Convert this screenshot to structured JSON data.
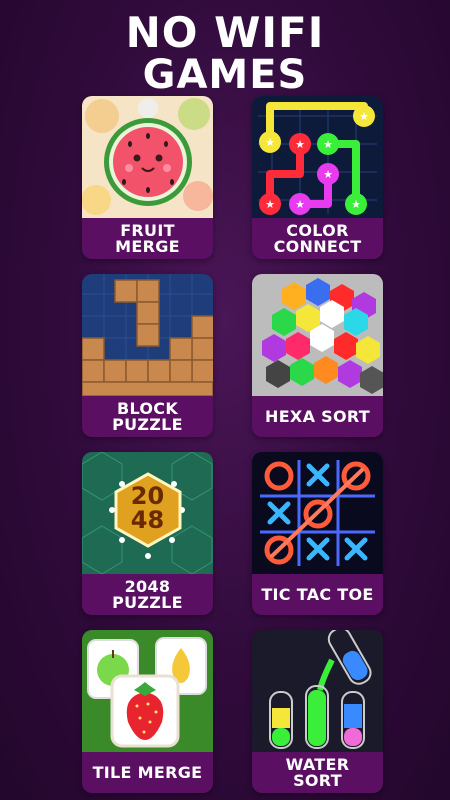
{
  "title": {
    "line1": "NO WIFI",
    "line2": "GAMES"
  },
  "games": [
    {
      "name": "FRUIT\nMERGE",
      "icon": "watermelon-icon"
    },
    {
      "name": "COLOR\nCONNECT",
      "icon": "color-connect-icon"
    },
    {
      "name": "BLOCK\nPUZZLE",
      "icon": "wood-blocks-icon"
    },
    {
      "name": "HEXA SORT",
      "icon": "hexagon-stack-icon"
    },
    {
      "name": "2048\nPUZZLE",
      "icon": "hex-2048-icon",
      "tile_text_top": "20",
      "tile_text_bottom": "48"
    },
    {
      "name": "TIC TAC TOE",
      "icon": "neon-tic-tac-toe-icon"
    },
    {
      "name": "TILE MERGE",
      "icon": "fruit-tiles-icon"
    },
    {
      "name": "WATER\nSORT",
      "icon": "water-tubes-icon"
    }
  ],
  "colors": {
    "label_bg": "#5b0f63",
    "page_bg": "#2f0a3a"
  }
}
